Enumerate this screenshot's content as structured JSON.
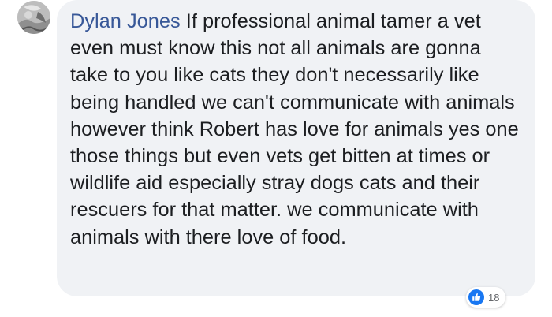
{
  "comment": {
    "author": "Dylan Jones",
    "text": "If professional animal tamer a vet even must know this not all animals are gonna take to you like cats they don't necessarily like being handled we can't communicate with animals however think Robert has love for animals yes one those things but even vets get bitten at times or wildlife aid especially stray dogs cats and their rescuers for that matter. we communicate with animals with there love of food."
  },
  "reactions": {
    "icon": "like-icon",
    "count": "18"
  },
  "colors": {
    "author_name": "#385898",
    "bubble_background": "#f0f2f5",
    "like_icon": "#1877f2"
  }
}
